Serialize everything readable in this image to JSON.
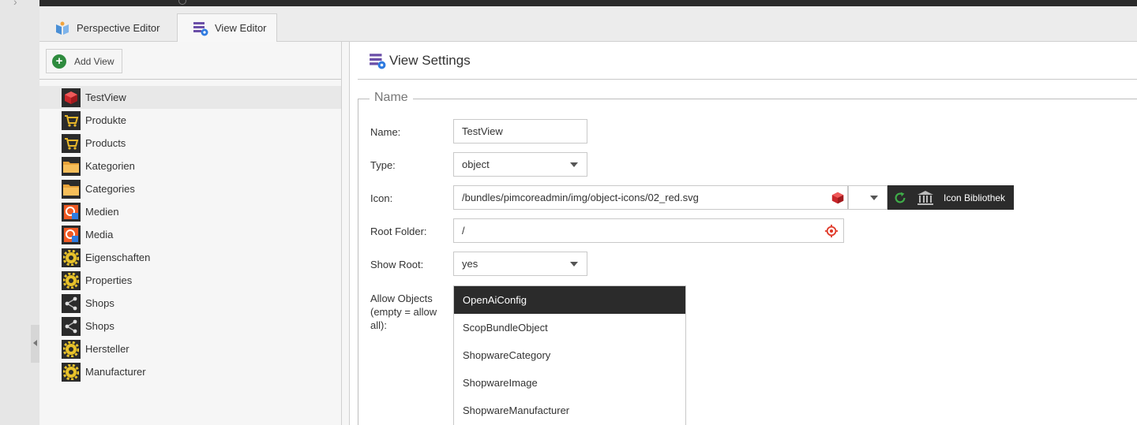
{
  "tabs": [
    {
      "label": "Perspective Editor",
      "icon": "perspective-icon"
    },
    {
      "label": "View Editor",
      "icon": "view-editor-icon",
      "active": true
    }
  ],
  "left": {
    "add_view_label": "Add View",
    "tree": [
      {
        "label": "TestView",
        "icon": "red-cube-icon",
        "selected": true
      },
      {
        "label": "Produkte",
        "icon": "cart-icon"
      },
      {
        "label": "Products",
        "icon": "cart-icon"
      },
      {
        "label": "Kategorien",
        "icon": "folder-icon"
      },
      {
        "label": "Categories",
        "icon": "folder-icon"
      },
      {
        "label": "Medien",
        "icon": "media-icon"
      },
      {
        "label": "Media",
        "icon": "media-icon"
      },
      {
        "label": "Eigenschaften",
        "icon": "gear-icon"
      },
      {
        "label": "Properties",
        "icon": "gear-icon"
      },
      {
        "label": "Shops",
        "icon": "share-icon"
      },
      {
        "label": "Shops",
        "icon": "share-icon"
      },
      {
        "label": "Hersteller",
        "icon": "gear-icon"
      },
      {
        "label": "Manufacturer",
        "icon": "gear-icon"
      }
    ]
  },
  "settings": {
    "title": "View Settings",
    "legend": "Name",
    "name": {
      "label": "Name:",
      "value": "TestView"
    },
    "type": {
      "label": "Type:",
      "value": "object"
    },
    "icon": {
      "label": "Icon:",
      "value": "/bundles/pimcoreadmin/img/object-icons/02_red.svg",
      "library_label": "Icon Bibliothek"
    },
    "root_folder": {
      "label": "Root Folder:",
      "value": "/"
    },
    "show_root": {
      "label": "Show Root:",
      "value": "yes"
    },
    "allow_objects": {
      "label_line1": "Allow Objects",
      "label_line2": "(empty = allow",
      "label_line3": "all):",
      "options": [
        {
          "label": "OpenAiConfig",
          "selected": true
        },
        {
          "label": "ScopBundleObject"
        },
        {
          "label": "ShopwareCategory"
        },
        {
          "label": "ShopwareImage"
        },
        {
          "label": "ShopwareManufacturer"
        }
      ]
    }
  },
  "colors": {
    "dark": "#2b2b2b",
    "accent_green": "#2e8b3e",
    "accent_red": "#e03a2a",
    "purple": "#6b4fa8"
  }
}
